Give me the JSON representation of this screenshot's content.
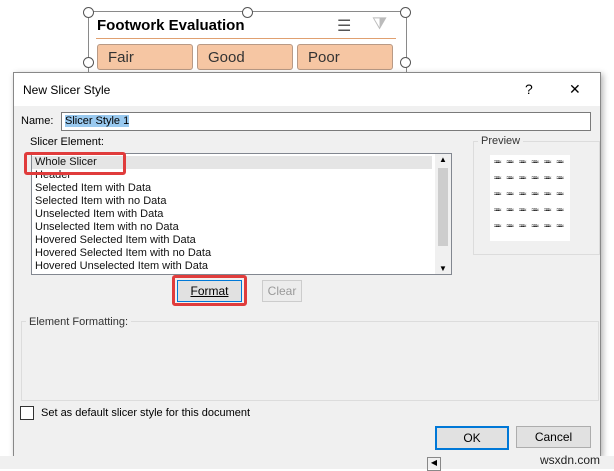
{
  "slicer": {
    "title": "Footwork Evaluation",
    "items": [
      "Fair",
      "Good",
      "Poor"
    ]
  },
  "dialog": {
    "title": "New Slicer Style",
    "help": "?",
    "close": "✕",
    "name_label": "Name:",
    "name_value": "Slicer Style 1",
    "element_label": "Slicer Element:",
    "elements": [
      "Whole Slicer",
      "Header",
      "Selected Item with Data",
      "Selected Item with no Data",
      "Unselected Item with Data",
      "Unselected Item with no Data",
      "Hovered Selected Item with Data",
      "Hovered Selected Item with no Data",
      "Hovered Unselected Item with Data"
    ],
    "preview_label": "Preview",
    "preview_glyph": "≈≈≈",
    "format": "Format",
    "clear": "Clear",
    "formatting_label": "Element Formatting:",
    "default_label": "Set as default slicer style for this document",
    "ok": "OK",
    "cancel": "Cancel",
    "highlight_color": "#e03c3c"
  },
  "watermark": "wsxdn.com"
}
